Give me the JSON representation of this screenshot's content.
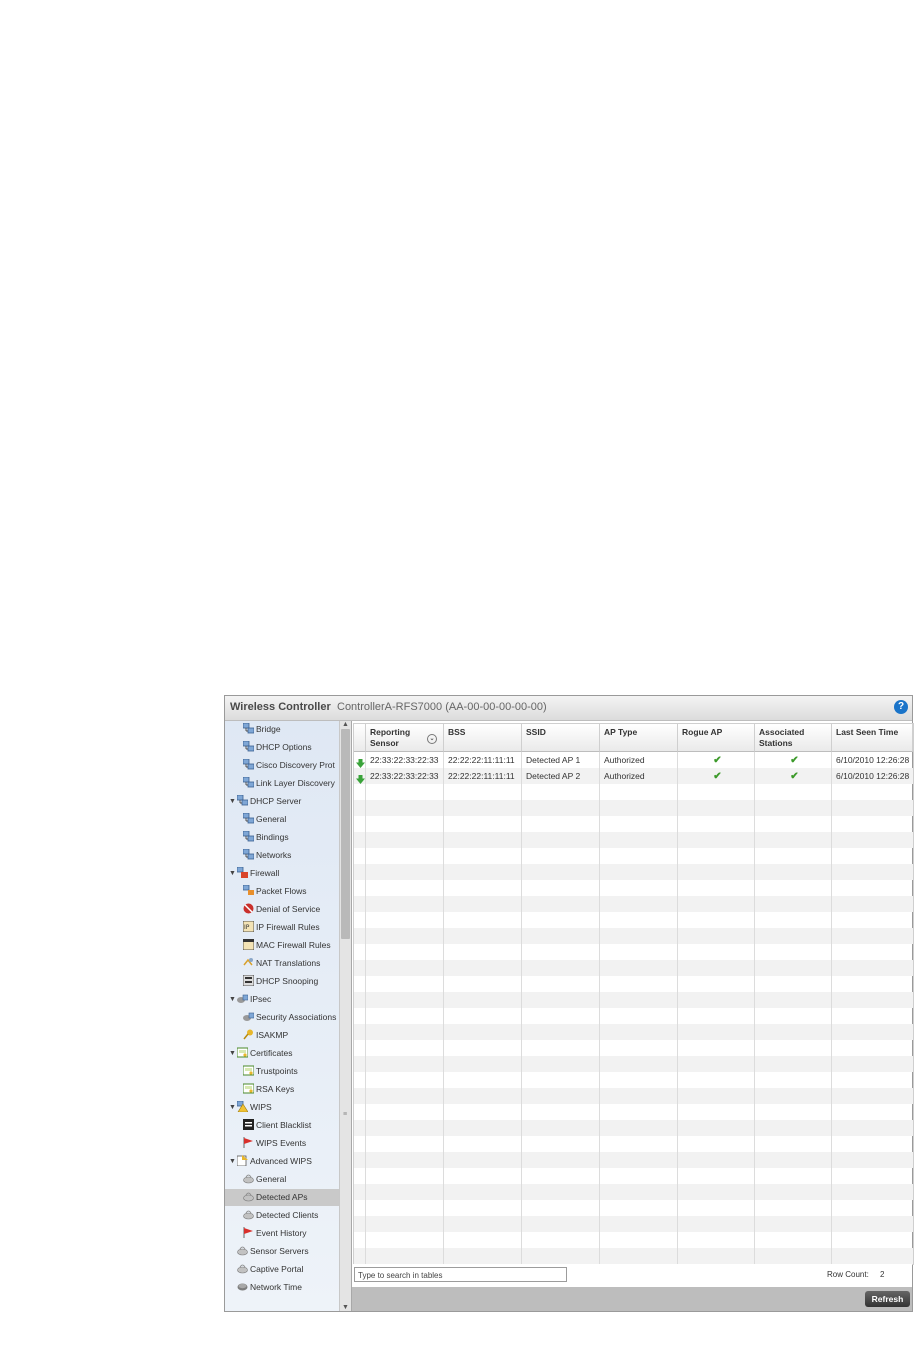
{
  "window": {
    "app_title": "Wireless Controller",
    "device_title": "ControllerA-RFS7000 (AA-00-00-00-00-00)",
    "help_glyph": "?"
  },
  "sidebar": {
    "items": [
      {
        "label": "Bridge",
        "level": 1,
        "icon": "network-icon"
      },
      {
        "label": "DHCP Options",
        "level": 1,
        "icon": "network-icon"
      },
      {
        "label": "Cisco Discovery Prot",
        "level": 1,
        "icon": "network-icon"
      },
      {
        "label": "Link Layer Discovery",
        "level": 1,
        "icon": "network-icon"
      },
      {
        "label": "DHCP Server",
        "level": 0,
        "icon": "network-icon",
        "expanded": true
      },
      {
        "label": "General",
        "level": 1,
        "icon": "network-icon"
      },
      {
        "label": "Bindings",
        "level": 1,
        "icon": "network-icon"
      },
      {
        "label": "Networks",
        "level": 1,
        "icon": "network-icon"
      },
      {
        "label": "Firewall",
        "level": 0,
        "icon": "firewall-icon",
        "expanded": true
      },
      {
        "label": "Packet Flows",
        "level": 1,
        "icon": "packet-flows-icon"
      },
      {
        "label": "Denial of Service",
        "level": 1,
        "icon": "denial-of-service-icon"
      },
      {
        "label": "IP Firewall Rules",
        "level": 1,
        "icon": "ip-rules-icon"
      },
      {
        "label": "MAC Firewall Rules",
        "level": 1,
        "icon": "mac-rules-icon"
      },
      {
        "label": "NAT Translations",
        "level": 1,
        "icon": "nat-icon"
      },
      {
        "label": "DHCP Snooping",
        "level": 1,
        "icon": "dhcp-snooping-icon"
      },
      {
        "label": "IPsec",
        "level": 0,
        "icon": "ipsec-icon",
        "expanded": true
      },
      {
        "label": "Security Associations",
        "level": 1,
        "icon": "ipsec-icon"
      },
      {
        "label": "ISAKMP",
        "level": 1,
        "icon": "key-icon"
      },
      {
        "label": "Certificates",
        "level": 0,
        "icon": "certificate-icon",
        "expanded": true
      },
      {
        "label": "Trustpoints",
        "level": 1,
        "icon": "certificate-icon"
      },
      {
        "label": "RSA Keys",
        "level": 1,
        "icon": "certificate-icon"
      },
      {
        "label": "WIPS",
        "level": 0,
        "icon": "wips-icon",
        "expanded": true
      },
      {
        "label": "Client Blacklist",
        "level": 1,
        "icon": "blacklist-icon"
      },
      {
        "label": "WIPS Events",
        "level": 1,
        "icon": "flag-icon"
      },
      {
        "label": "Advanced WIPS",
        "level": 0,
        "icon": "advanced-wips-icon",
        "expanded": true
      },
      {
        "label": "General",
        "level": 1,
        "icon": "sensor-icon"
      },
      {
        "label": "Detected APs",
        "level": 1,
        "icon": "sensor-icon",
        "selected": true
      },
      {
        "label": "Detected Clients",
        "level": 1,
        "icon": "sensor-icon"
      },
      {
        "label": "Event History",
        "level": 1,
        "icon": "flag-icon"
      },
      {
        "label": "Sensor Servers",
        "level": 0,
        "icon": "sensor-icon"
      },
      {
        "label": "Captive Portal",
        "level": 0,
        "icon": "sensor-icon"
      },
      {
        "label": "Network Time",
        "level": 0,
        "icon": "network-time-icon"
      }
    ]
  },
  "table": {
    "columns": [
      {
        "label": "Reporting\nSensor"
      },
      {
        "label": "BSS"
      },
      {
        "label": "SSID"
      },
      {
        "label": "AP Type"
      },
      {
        "label": "Rogue AP"
      },
      {
        "label": "Associated\nStations"
      },
      {
        "label": "Last Seen Time"
      }
    ],
    "rows": [
      {
        "sensor": "22:33:22:33:22:33",
        "bss": "22:22:22:11:11:11",
        "ssid": "Detected AP 1",
        "ap_type": "Authorized",
        "rogue": true,
        "assoc": true,
        "last_seen": "6/10/2010 12:26:28 P"
      },
      {
        "sensor": "22:33:22:33:22:33",
        "bss": "22:22:22:11:11:11",
        "ssid": "Detected AP 2",
        "ap_type": "Authorized",
        "rogue": true,
        "assoc": true,
        "last_seen": "6/10/2010 12:26:28 P"
      }
    ]
  },
  "footer": {
    "search_placeholder": "Type to search in tables",
    "row_count_label": "Row Count:",
    "row_count_value": "2",
    "refresh_label": "Refresh"
  },
  "colors": {
    "accent": "#1a74c9",
    "selected_row": "#c9c9c9",
    "check_green": "#3c9a2a"
  }
}
